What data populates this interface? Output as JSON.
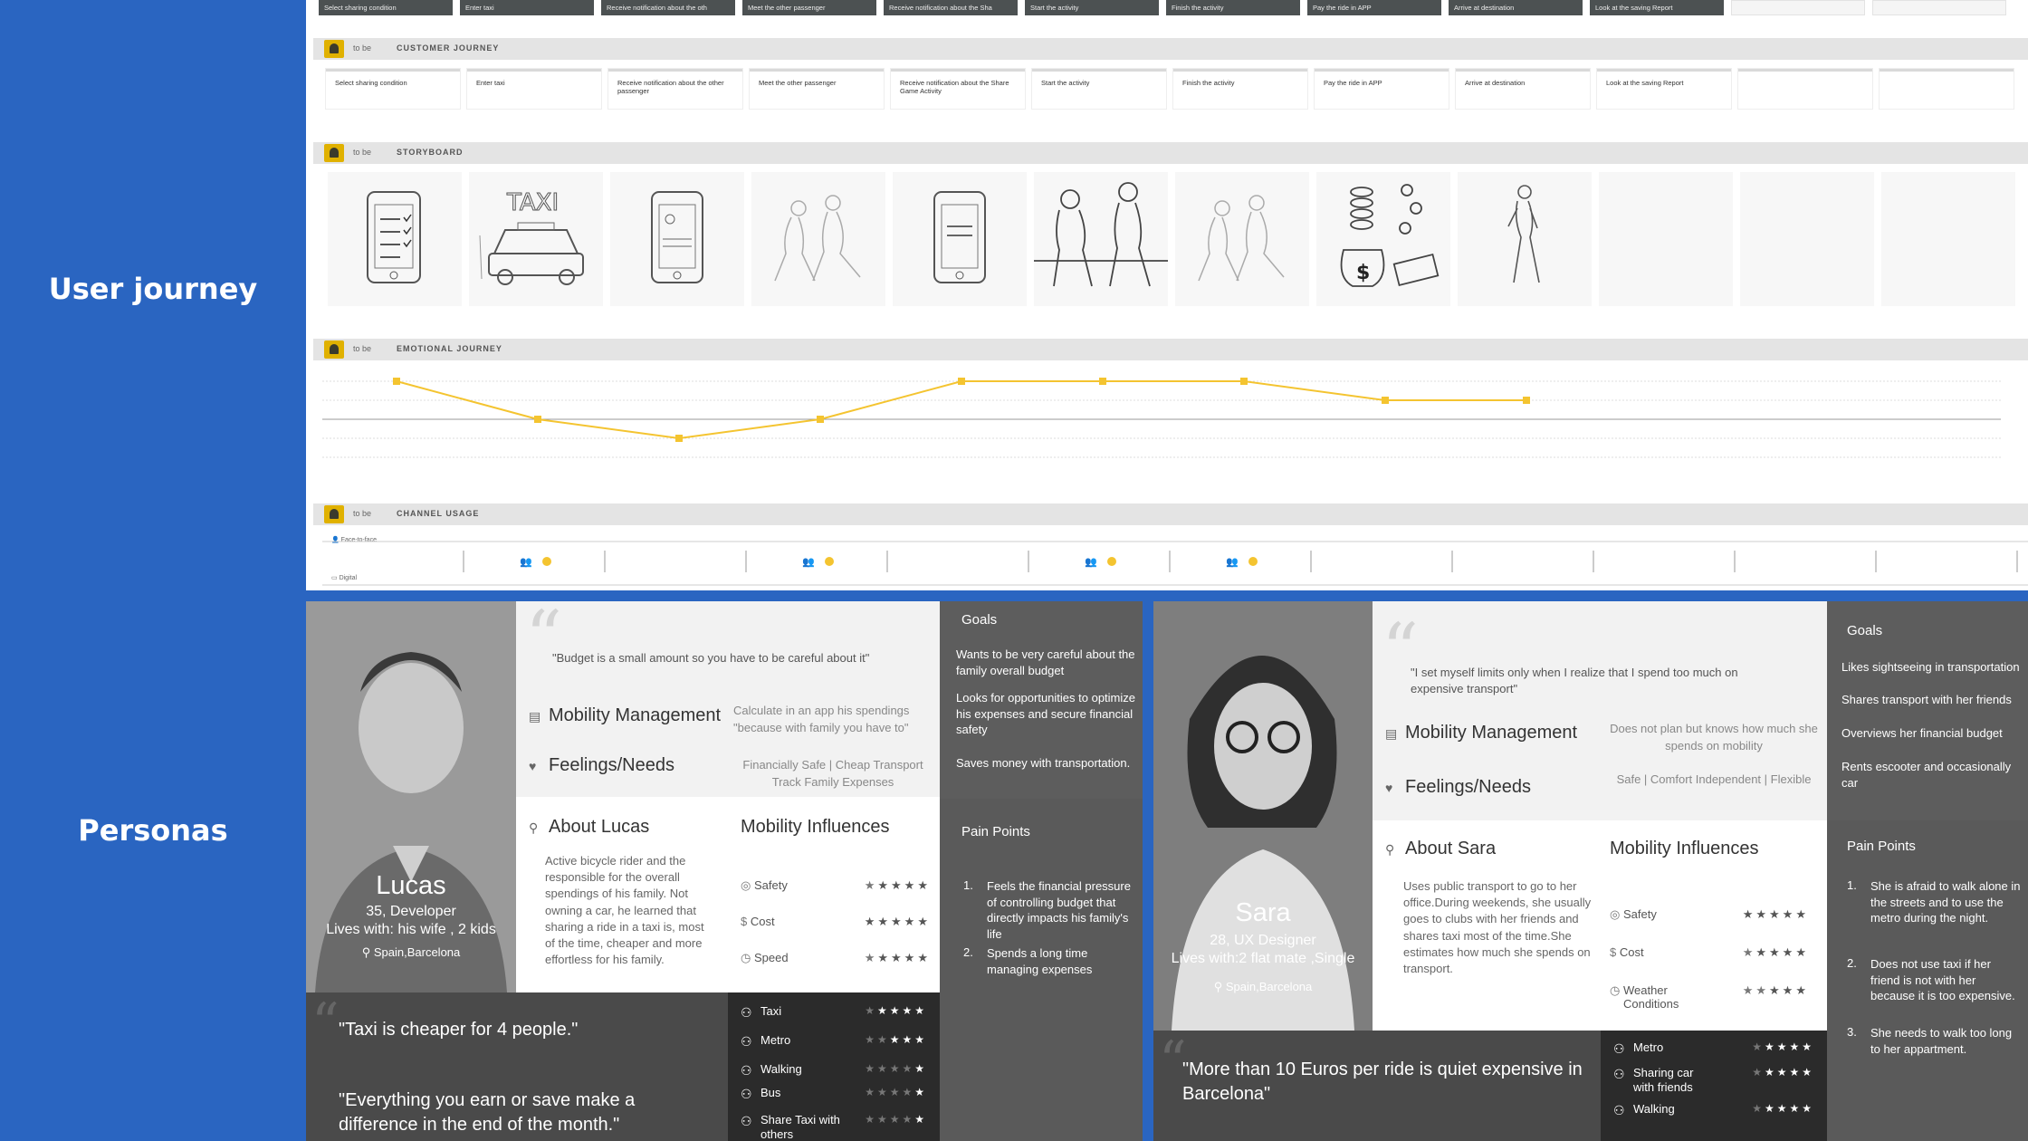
{
  "sidebar": {
    "user_journey_label": "User journey",
    "personas_label": "Personas"
  },
  "board": {
    "to_be": "to be",
    "actions_row": [
      "Select sharing condition",
      "Enter taxi",
      "Receive notification about the oth",
      "Meet the other passenger",
      "Receive notification about the Sha",
      "Start the activity",
      "Finish the activity",
      "Pay the ride in APP",
      "Arrive at destination",
      "Look at the saving Report"
    ],
    "customer_journey": {
      "title": "CUSTOMER JOURNEY",
      "cells": [
        "Select sharing condition",
        "Enter taxi",
        "Receive notification about the other passenger",
        "Meet the other passenger",
        "Receive notification about the Share Game Activity",
        "Start the activity",
        "Finish the activity",
        "Pay the ride in APP",
        "Arrive at destination",
        "Look at the saving Report"
      ]
    },
    "storyboard": {
      "title": "STORYBOARD",
      "taxi_text": "TAXI",
      "dollar_sign": "$"
    },
    "emotional_journey": {
      "title": "EMOTIONAL JOURNEY",
      "levels": [
        2,
        0,
        -1,
        0,
        2,
        2,
        2,
        1,
        1
      ]
    },
    "channel_usage": {
      "title": "CHANNEL USAGE",
      "face_label": "Face-to-face",
      "digital_label": "Digital"
    }
  },
  "lucas": {
    "name": "Lucas",
    "role": "35, Developer",
    "lives": "Lives with: his wife , 2 kids",
    "location": "Spain,Barcelona",
    "quote": "\"Budget is a small amount so you have to be careful about it\"",
    "mobility_title": "Mobility Management",
    "mobility_text": "Calculate in an app his spendings \"because with family you have to\"",
    "feelings_title": "Feelings/Needs",
    "feelings_text": "Financially Safe | Cheap Transport Track Family Expenses",
    "about_title": "About Lucas",
    "about_text": "Active bicycle rider and the responsible for the overall spendings of his family. Not owning a car, he learned that sharing a ride in a taxi is, most of the time, cheaper and more effortless for his family.",
    "influences_title": "Mobility Influences",
    "influences": [
      {
        "label": "Safety",
        "stars": 4
      },
      {
        "label": "Cost",
        "stars": 5
      },
      {
        "label": "Speed",
        "stars": 4
      }
    ],
    "goals_title": "Goals",
    "goals": [
      "Wants to be very careful about the family overall budget",
      "Looks for opportunities to optimize his expenses and secure financial safety",
      "Saves money with transportation."
    ],
    "pain_title": "Pain Points",
    "pains": [
      "Feels the financial pressure of controlling budget that directly impacts his family's life",
      "Spends a long time managing expenses"
    ],
    "quotes": [
      "\"Taxi is cheaper for 4 people.\"",
      "\"Everything you earn or save make a difference in the end of the month.\""
    ],
    "transport": [
      {
        "label": "Taxi",
        "stars": 4
      },
      {
        "label": "Metro",
        "stars": 3
      },
      {
        "label": "Walking",
        "stars": 1
      },
      {
        "label": "Bus",
        "stars": 1
      },
      {
        "label": "Share Taxi with others",
        "stars": 1
      }
    ]
  },
  "sara": {
    "name": "Sara",
    "role": "28, UX Designer",
    "lives": "Lives with:2 flat mate ,Single",
    "location": "Spain,Barcelona",
    "quote": "\"I set myself limits only when I realize that I spend too much on expensive transport\"",
    "mobility_title": "Mobility Management",
    "mobility_text": "Does not plan but knows how much she spends on mobility",
    "feelings_title": "Feelings/Needs",
    "feelings_text": "Safe | Comfort Independent | Flexible",
    "about_title": "About Sara",
    "about_text": "Uses public transport to go to her office.During weekends, she usually goes to clubs with her friends and shares taxi most of the time.She estimates how much she spends on transport.",
    "influences_title": "Mobility Influences",
    "influences": [
      {
        "label": "Safety",
        "stars": 5
      },
      {
        "label": "Cost",
        "stars": 4
      },
      {
        "label": "Weather Conditions",
        "stars": 3
      }
    ],
    "goals_title": "Goals",
    "goals": [
      "Likes sightseeing in transportation",
      "Shares transport with her friends",
      "Overviews her financial budget",
      "Rents escooter and occasionally car"
    ],
    "pain_title": "Pain Points",
    "pains": [
      "She is afraid to walk alone in the streets and to use the metro during the night.",
      "Does not use taxi if her friend is not with her because it is too expensive.",
      "She needs to walk too long to her appartment."
    ],
    "quotes": [
      "\"More than 10 Euros per ride is quiet expensive in Barcelona\""
    ],
    "transport": [
      {
        "label": "Metro",
        "stars": 4
      },
      {
        "label": "Sharing car with friends",
        "stars": 4
      },
      {
        "label": "Walking",
        "stars": 4
      }
    ]
  },
  "colors": {
    "brand_blue": "#2a65c1",
    "accent_yellow": "#f4c430"
  }
}
